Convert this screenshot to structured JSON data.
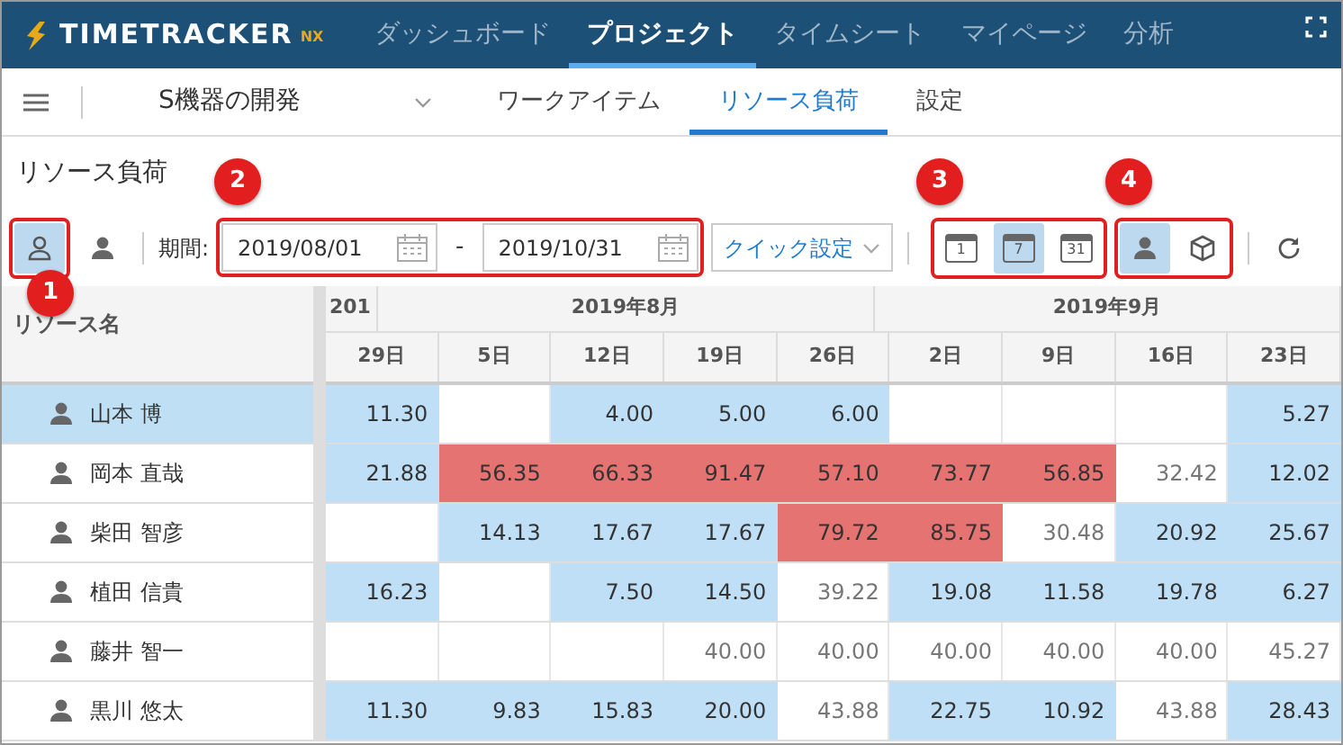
{
  "app": {
    "logo": "TIMETRACKER",
    "logo_suffix": "NX"
  },
  "main_nav": [
    {
      "label": "ダッシュボード",
      "selected": false
    },
    {
      "label": "プロジェクト",
      "selected": true
    },
    {
      "label": "タイムシート",
      "selected": false
    },
    {
      "label": "マイページ",
      "selected": false
    },
    {
      "label": "分析",
      "selected": false
    }
  ],
  "project_select": {
    "value": "S機器の開発"
  },
  "sub_tabs": [
    {
      "label": "ワークアイテム",
      "selected": false
    },
    {
      "label": "リソース負荷",
      "selected": true
    },
    {
      "label": "設定",
      "selected": false
    }
  ],
  "page_title": "リソース負荷",
  "toolbar": {
    "view_buttons": [
      {
        "kind": "person-outline",
        "selected": true
      },
      {
        "kind": "person",
        "selected": false
      }
    ],
    "period_label": "期間:",
    "start_date": "2019/08/01",
    "separator": "-",
    "end_date": "2019/10/31",
    "quick_button": "クイック設定",
    "scale_buttons": [
      {
        "label": "1",
        "selected": false
      },
      {
        "label": "7",
        "selected": true
      },
      {
        "label": "31",
        "selected": false
      }
    ],
    "mode_buttons": [
      {
        "kind": "person",
        "selected": true
      },
      {
        "kind": "cube",
        "selected": false
      }
    ]
  },
  "callouts": [
    "1",
    "2",
    "3",
    "4"
  ],
  "table": {
    "name_header": "リソース名",
    "months": [
      "201",
      "2019年8月",
      "2019年9月"
    ],
    "days": [
      "29日",
      "5日",
      "12日",
      "19日",
      "26日",
      "2日",
      "9日",
      "16日",
      "23日"
    ],
    "rows": [
      {
        "name": "山本 博",
        "selected": true,
        "cells": [
          {
            "value": "11.30",
            "kind": "under"
          },
          {
            "kind": "empty"
          },
          {
            "value": "4.00",
            "kind": "under"
          },
          {
            "value": "5.00",
            "kind": "under"
          },
          {
            "value": "6.00",
            "kind": "under"
          },
          {
            "kind": "empty"
          },
          {
            "kind": "empty"
          },
          {
            "kind": "empty"
          },
          {
            "value": "5.27",
            "kind": "under"
          }
        ]
      },
      {
        "name": "岡本 直哉",
        "selected": false,
        "cells": [
          {
            "value": "21.88",
            "kind": "under"
          },
          {
            "value": "56.35",
            "kind": "over"
          },
          {
            "value": "66.33",
            "kind": "over"
          },
          {
            "value": "91.47",
            "kind": "over"
          },
          {
            "value": "57.10",
            "kind": "over"
          },
          {
            "value": "73.77",
            "kind": "over"
          },
          {
            "value": "56.85",
            "kind": "over"
          },
          {
            "value": "32.42",
            "kind": "normal"
          },
          {
            "value": "12.02",
            "kind": "under"
          }
        ]
      },
      {
        "name": "柴田 智彦",
        "selected": false,
        "cells": [
          {
            "kind": "empty"
          },
          {
            "value": "14.13",
            "kind": "under"
          },
          {
            "value": "17.67",
            "kind": "under"
          },
          {
            "value": "17.67",
            "kind": "under"
          },
          {
            "value": "79.72",
            "kind": "over"
          },
          {
            "value": "85.75",
            "kind": "over"
          },
          {
            "value": "30.48",
            "kind": "normal"
          },
          {
            "value": "20.92",
            "kind": "under"
          },
          {
            "value": "25.67",
            "kind": "under"
          }
        ]
      },
      {
        "name": "植田 信貴",
        "selected": false,
        "cells": [
          {
            "value": "16.23",
            "kind": "under"
          },
          {
            "kind": "empty"
          },
          {
            "value": "7.50",
            "kind": "under"
          },
          {
            "value": "14.50",
            "kind": "under"
          },
          {
            "value": "39.22",
            "kind": "normal"
          },
          {
            "value": "19.08",
            "kind": "under"
          },
          {
            "value": "11.58",
            "kind": "under"
          },
          {
            "value": "19.78",
            "kind": "under"
          },
          {
            "value": "6.27",
            "kind": "under"
          }
        ]
      },
      {
        "name": "藤井 智一",
        "selected": false,
        "cells": [
          {
            "kind": "empty"
          },
          {
            "kind": "empty"
          },
          {
            "kind": "empty"
          },
          {
            "value": "40.00",
            "kind": "normal"
          },
          {
            "value": "40.00",
            "kind": "normal"
          },
          {
            "value": "40.00",
            "kind": "normal"
          },
          {
            "value": "40.00",
            "kind": "normal"
          },
          {
            "value": "40.00",
            "kind": "normal"
          },
          {
            "value": "45.27",
            "kind": "normal"
          }
        ]
      },
      {
        "name": "黒川 悠太",
        "selected": false,
        "cells": [
          {
            "value": "11.30",
            "kind": "under"
          },
          {
            "value": "9.83",
            "kind": "under"
          },
          {
            "value": "15.83",
            "kind": "under"
          },
          {
            "value": "20.00",
            "kind": "under"
          },
          {
            "value": "43.88",
            "kind": "normal"
          },
          {
            "value": "22.75",
            "kind": "under"
          },
          {
            "value": "10.92",
            "kind": "under"
          },
          {
            "value": "43.88",
            "kind": "normal"
          },
          {
            "value": "28.43",
            "kind": "under"
          }
        ]
      }
    ]
  }
}
